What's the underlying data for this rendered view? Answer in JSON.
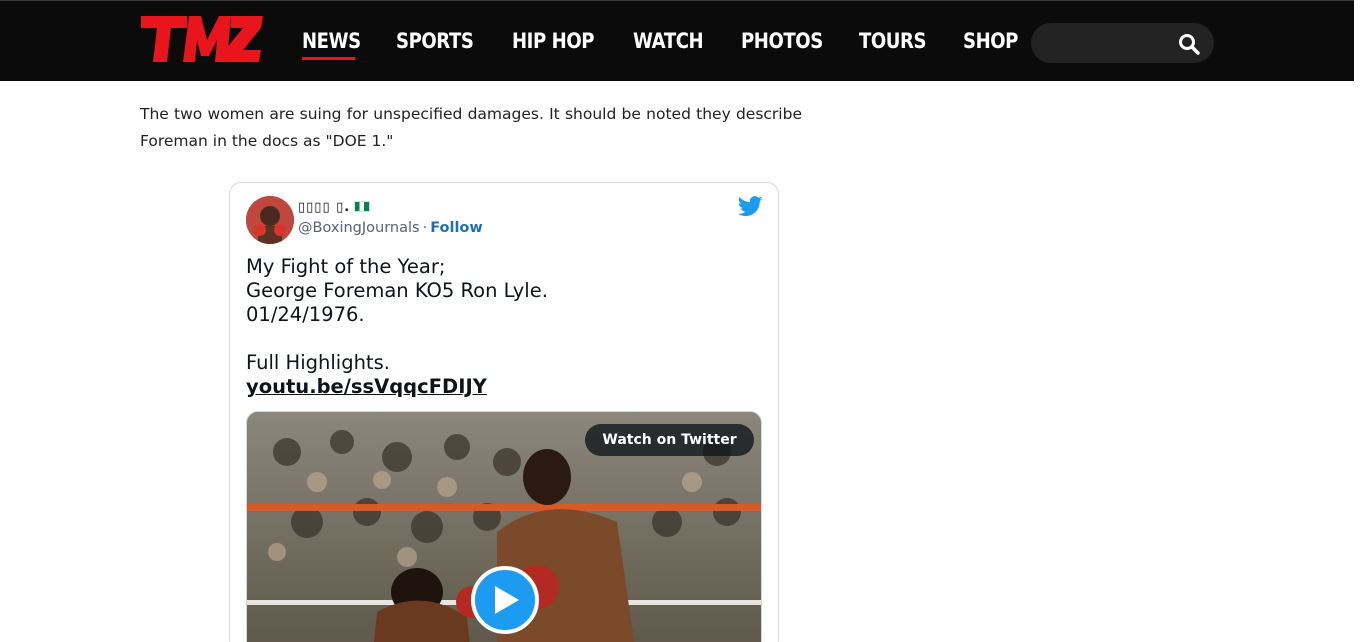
{
  "header": {
    "logo_text": "TMZ",
    "accent_color": "#e8161c",
    "nav": [
      {
        "label": "NEWS",
        "active": true
      },
      {
        "label": "SPORTS",
        "active": false
      },
      {
        "label": "HIP HOP",
        "active": false
      },
      {
        "label": "WATCH",
        "active": false
      },
      {
        "label": "PHOTOS",
        "active": false
      },
      {
        "label": "TOURS",
        "active": false
      },
      {
        "label": "SHOP",
        "active": false
      }
    ],
    "search": {
      "placeholder": "",
      "icon": "search-icon"
    }
  },
  "article": {
    "paragraph": "The two women are suing for unspecified damages. It should be noted they describe Foreman in the docs as \"DOE 1.\""
  },
  "tweet": {
    "display_name": "▯▯▯▯ ▯.",
    "handle": "@BoxingJournals",
    "separator": "·",
    "follow_label": "Follow",
    "text": "My Fight of the Year;\nGeorge Foreman KO5 Ron Lyle.\n01/24/1976.\n\nFull Highlights.",
    "link": "youtu.be/ssVqqcFDIJY",
    "media": {
      "watch_label": "Watch on Twitter",
      "play_icon": "play-icon"
    },
    "brand_icon": "twitter-bird-icon",
    "colors": {
      "link": "#1d70b8",
      "play": "#1d9bf0"
    }
  }
}
